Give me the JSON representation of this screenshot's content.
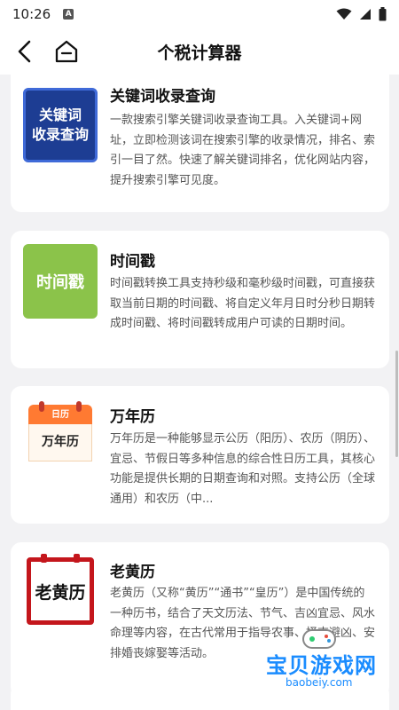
{
  "status_bar": {
    "time": "10:26",
    "notif_letter": "A"
  },
  "header": {
    "title": "个税计算器"
  },
  "icons": {
    "back": "chevron-left-icon",
    "home": "home-icon"
  },
  "cards": [
    {
      "title": "关键词收录查询",
      "icon_text_line1": "关键词",
      "icon_text_line2": "收录查询",
      "description": "一款搜索引擎关键词收录查询工具。入关键词+网址，立即检测该词在搜索引擎的收录情况，排名、索引一目了然。快速了解关键词排名，优化网站内容，提升搜索引擎可见度。"
    },
    {
      "title": "时间戳",
      "icon_text": "时间戳",
      "description": "时间戳转换工具支持秒级和毫秒级时间戳，可直接获取当前日期的时间戳、将自定义年月日时分秒日期转成时间戳、将时间戳转成用户可读的日期时间。"
    },
    {
      "title": "万年历",
      "icon_tag": "日历",
      "icon_text": "万年历",
      "description": "万年历是一种能够显示公历（阳历）、农历（阴历）、宜忌、节假日等多种信息的综合性日历工具，其核心功能是提供长期的日期查询和对照。支持公历（全球通用）和农历（中..."
    },
    {
      "title": "老黄历",
      "icon_text": "老黄历",
      "description": "老黄历（又称“黄历”“通书”“皇历”）是中国传统的一种历书，结合了天文历法、节气、吉凶宜忌、风水命理等内容，在古代常用于指导农事、择吉避凶、安排婚丧嫁娶等活动。"
    }
  ],
  "watermark": {
    "text": "宝贝游戏网",
    "url": "baobeiy.com"
  },
  "colors": {
    "kw_bg": "#1d3d93",
    "ts_bg": "#8bc34a",
    "cal_accent": "#ff7a32",
    "hl_red": "#c4161c"
  }
}
